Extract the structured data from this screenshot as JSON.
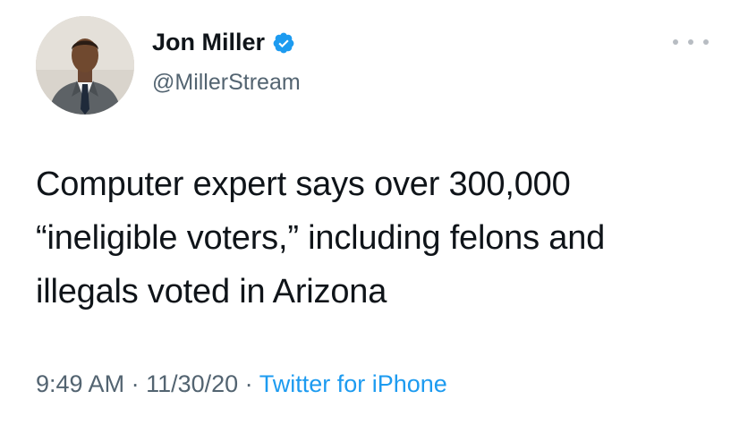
{
  "user": {
    "display_name": "Jon Miller",
    "handle": "@MillerStream",
    "verified": true,
    "avatar_icon": "profile-photo"
  },
  "tweet": {
    "text_lines": [
      "Computer expert says over 300,000",
      "“ineligible voters,” including felons and",
      "illegals voted in Arizona"
    ]
  },
  "meta": {
    "time": "9:49 AM",
    "separator": " · ",
    "date": "11/30/20",
    "source": "Twitter for iPhone"
  },
  "colors": {
    "text": "#0f1419",
    "secondary": "#536471",
    "link": "#1d9bf0",
    "verified": "#1d9bf0"
  },
  "icons": {
    "more": "more-icon",
    "verified": "verified-icon"
  }
}
